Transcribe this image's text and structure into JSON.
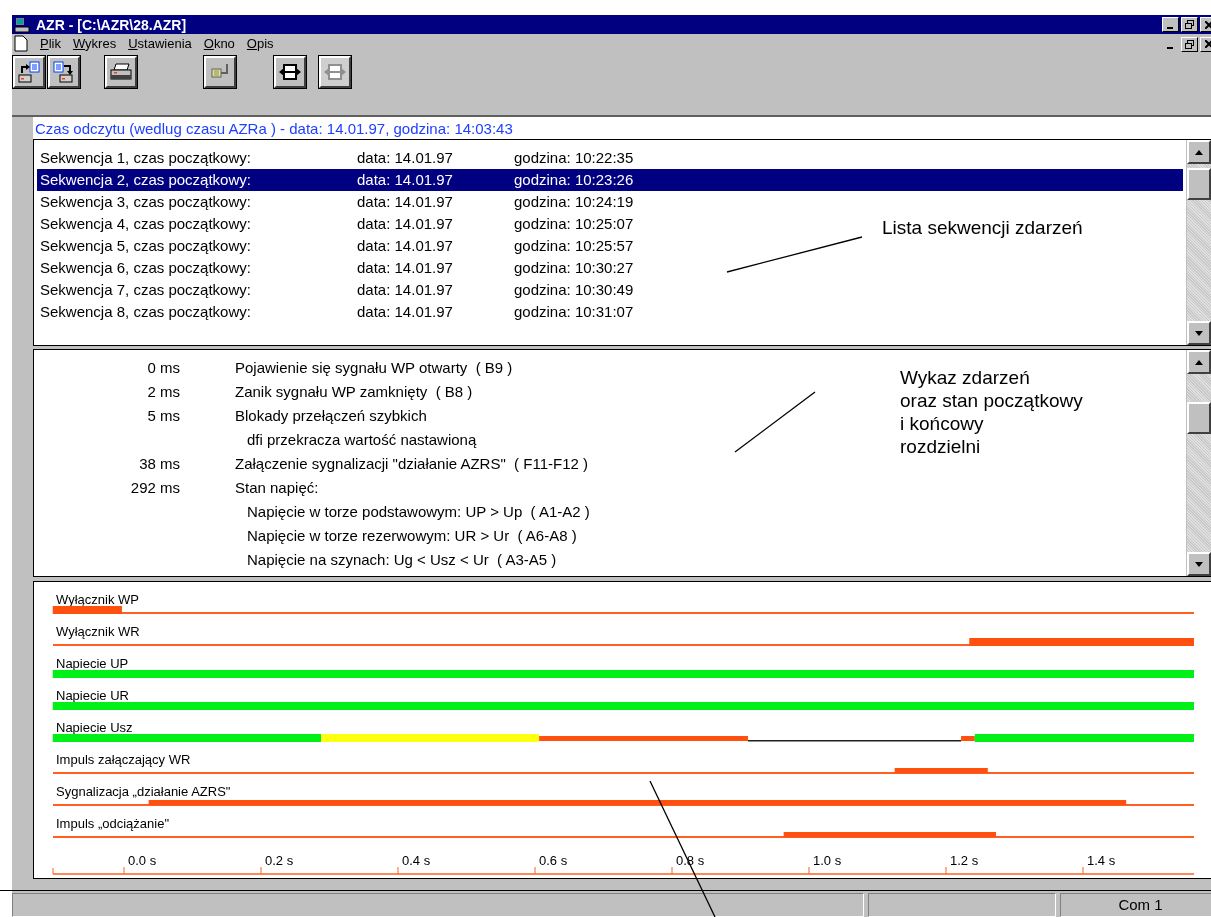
{
  "window": {
    "title": "AZR - [C:\\AZR\\28.AZR]"
  },
  "menu": [
    {
      "accel": "P",
      "rest": "lik"
    },
    {
      "accel": "W",
      "rest": "ykres"
    },
    {
      "accel": "U",
      "rest": "stawienia"
    },
    {
      "accel": "O",
      "rest": "kno"
    },
    {
      "accel": "O",
      "rest": "pis"
    }
  ],
  "toolbar": [
    {
      "kind": "open",
      "disabled": false
    },
    {
      "kind": "save",
      "disabled": false
    },
    {
      "kind": "print",
      "disabled": false
    },
    {
      "kind": "plug",
      "disabled": false
    },
    {
      "kind": "connect",
      "disabled": false
    },
    {
      "kind": "connect",
      "disabled": true
    }
  ],
  "header": "Czas odczytu (wedlug czasu AZRa ) - data: 14.01.97, godzina: 14:03:43",
  "sequences": [
    {
      "name": "Sekwencja 1, czas początkowy:",
      "date": "data: 14.01.97",
      "time": "godzina: 10:22:35",
      "selected": false
    },
    {
      "name": "Sekwencja 2, czas początkowy:",
      "date": "data: 14.01.97",
      "time": "godzina: 10:23:26",
      "selected": true
    },
    {
      "name": "Sekwencja 3, czas początkowy:",
      "date": "data: 14.01.97",
      "time": "godzina: 10:24:19",
      "selected": false
    },
    {
      "name": "Sekwencja 4, czas początkowy:",
      "date": "data: 14.01.97",
      "time": "godzina: 10:25:07",
      "selected": false
    },
    {
      "name": "Sekwencja 5, czas początkowy:",
      "date": "data: 14.01.97",
      "time": "godzina: 10:25:57",
      "selected": false
    },
    {
      "name": "Sekwencja 6, czas początkowy:",
      "date": "data: 14.01.97",
      "time": "godzina: 10:30:27",
      "selected": false
    },
    {
      "name": "Sekwencja 7, czas początkowy:",
      "date": "data: 14.01.97",
      "time": "godzina: 10:30:49",
      "selected": false
    },
    {
      "name": "Sekwencja 8, czas początkowy:",
      "date": "data: 14.01.97",
      "time": "godzina: 10:31:07",
      "selected": false
    }
  ],
  "events": [
    {
      "time": "0 ms",
      "text": "Pojawienie się sygnału WP otwarty  ( B9 )"
    },
    {
      "time": "2 ms",
      "text": "Zanik sygnału WP zamknięty  ( B8 )"
    },
    {
      "time": "5 ms",
      "text": "Blokady przełączeń szybkich",
      "details": [
        "dfi przekracza wartość nastawioną"
      ]
    },
    {
      "time": "38 ms",
      "text": "Załączenie sygnalizacji \"działanie AZRS\"  ( F11-F12 )"
    },
    {
      "time": "292 ms",
      "text": "Stan napięć:",
      "details": [
        "Napięcie w torze podstawowym: UP > Up  ( A1-A2 )",
        "Napięcie w torze rezerwowym: UR > Ur  ( A6-A8 )",
        "Napięcie na szynach: Ug < Usz < Ur  ( A3-A5 )"
      ]
    }
  ],
  "timing_chart": {
    "xtick_labels": [
      "0.0 s",
      "0.2 s",
      "0.4 s",
      "0.6 s",
      "0.8 s",
      "1.0 s",
      "1.2 s",
      "1.4 s"
    ],
    "signals": [
      {
        "label": "Wyłącznik WP",
        "baseline": true,
        "segments": [
          {
            "kind": "bar",
            "color": "#ff5010"
          }
        ]
      },
      {
        "label": "Wyłącznik WR",
        "baseline": true,
        "segments": [
          {
            "kind": "bar",
            "color": "#ff5010"
          }
        ]
      },
      {
        "label": "Napiecie UP",
        "baseline": true,
        "segments": [
          {
            "kind": "bar",
            "color": "#00f018"
          }
        ]
      },
      {
        "label": "Napiecie UR",
        "baseline": true,
        "segments": [
          {
            "kind": "bar",
            "color": "#00f018"
          }
        ]
      },
      {
        "label": "Napiecie Usz",
        "baseline": false,
        "segments": [
          {
            "kind": "bar",
            "color": "#00f018"
          },
          {
            "kind": "bar",
            "color": "#ffff10"
          },
          {
            "kind": "band",
            "color": "#ff5010"
          },
          {
            "kind": "line",
            "color": "#202020"
          },
          {
            "kind": "band",
            "color": "#ff5010"
          },
          {
            "kind": "bar",
            "color": "#00f018"
          }
        ]
      },
      {
        "label": "Impuls załączający WR",
        "baseline": true,
        "segments": [
          {
            "kind": "band",
            "color": "#ff5010"
          }
        ]
      },
      {
        "label": "Sygnalizacja „działanie AZRS\"",
        "baseline": true,
        "segments": [
          {
            "kind": "band",
            "color": "#ff5010"
          }
        ]
      },
      {
        "label": "Impuls „odciążanie\"",
        "baseline": true,
        "segments": [
          {
            "kind": "band",
            "color": "#ff5010"
          }
        ]
      }
    ]
  },
  "annotations": [
    {
      "text": "Lista sekwencji zdarzeń"
    },
    {
      "text": "Wykaz zdarzeń\noraz stan początkowy\ni końcowy\nrozdzielni"
    }
  ],
  "status_bar": {
    "port": "Com 1"
  }
}
